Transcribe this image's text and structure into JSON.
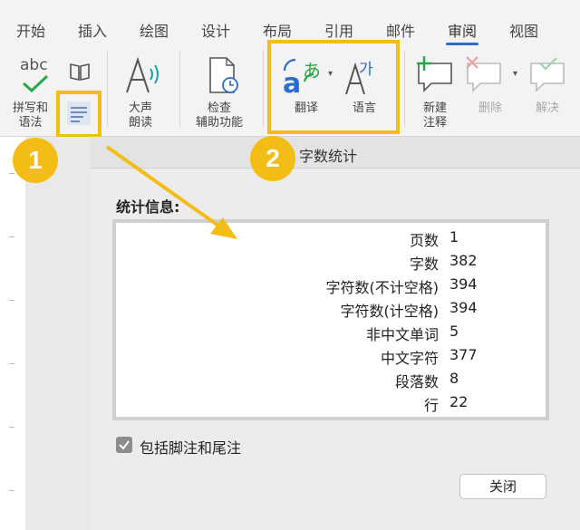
{
  "ribbon": {
    "tabs": [
      {
        "label": "开始"
      },
      {
        "label": "插入"
      },
      {
        "label": "绘图"
      },
      {
        "label": "设计"
      },
      {
        "label": "布局"
      },
      {
        "label": "引用"
      },
      {
        "label": "邮件"
      },
      {
        "label": "审阅"
      },
      {
        "label": "视图"
      }
    ],
    "active_tab": "审阅",
    "buttons": {
      "spelling": {
        "icon_text": "abc",
        "label_line1": "拼写和",
        "label_line2": "语法"
      },
      "read_aloud": {
        "label_line1": "大声",
        "label_line2": "朗读"
      },
      "accessibility": {
        "label_line1": "检查",
        "label_line2": "辅助功能"
      },
      "translate": {
        "icon_glyph": "あ",
        "label": "翻译"
      },
      "language": {
        "icon_glyph": "가",
        "label": "语言"
      },
      "new_comment": {
        "label_line1": "新建",
        "label_line2": "注释"
      },
      "delete": {
        "label": "删除"
      },
      "resolve": {
        "label": "解决"
      }
    }
  },
  "callouts": [
    "1",
    "2"
  ],
  "dialog": {
    "title": "字数统计",
    "stats_header": "统计信息:",
    "stats": [
      {
        "label": "页数",
        "value": "1"
      },
      {
        "label": "字数",
        "value": "382"
      },
      {
        "label": "字符数(不计空格)",
        "value": "394"
      },
      {
        "label": "字符数(计空格)",
        "value": "394"
      },
      {
        "label": "非中文单词",
        "value": "5"
      },
      {
        "label": "中文字符",
        "value": "377"
      },
      {
        "label": "段落数",
        "value": "8"
      },
      {
        "label": "行",
        "value": "22"
      }
    ],
    "include_footnotes": {
      "label": "包括脚注和尾注",
      "checked": true
    },
    "close_label": "关闭"
  },
  "colors": {
    "highlight": "#f4bd16",
    "accent": "#2b6cd1",
    "green": "#27a845",
    "teal": "#19a6a0"
  }
}
